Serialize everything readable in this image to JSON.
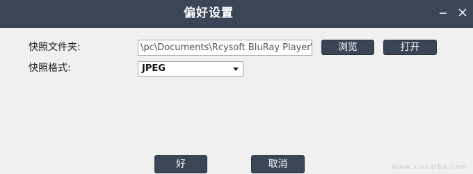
{
  "dialog": {
    "title": "偏好设置",
    "minimize_icon": "minimize-icon",
    "close_icon": "close-icon"
  },
  "snapshot_folder": {
    "label": "快照文件夹:",
    "value": "\\pc\\Documents\\Rcysoft BluRay Player\\",
    "browse_label": "浏览",
    "open_label": "打开"
  },
  "snapshot_format": {
    "label": "快照格式:",
    "selected": "JPEG",
    "arrow_icon": "dropdown-arrow-icon"
  },
  "footer": {
    "ok_label": "好",
    "cancel_label": "取消"
  },
  "watermark": "www.xiazaiba.com",
  "colors": {
    "titlebar": "#3a4556",
    "button": "#3a4556",
    "background": "#f0f0f0"
  }
}
